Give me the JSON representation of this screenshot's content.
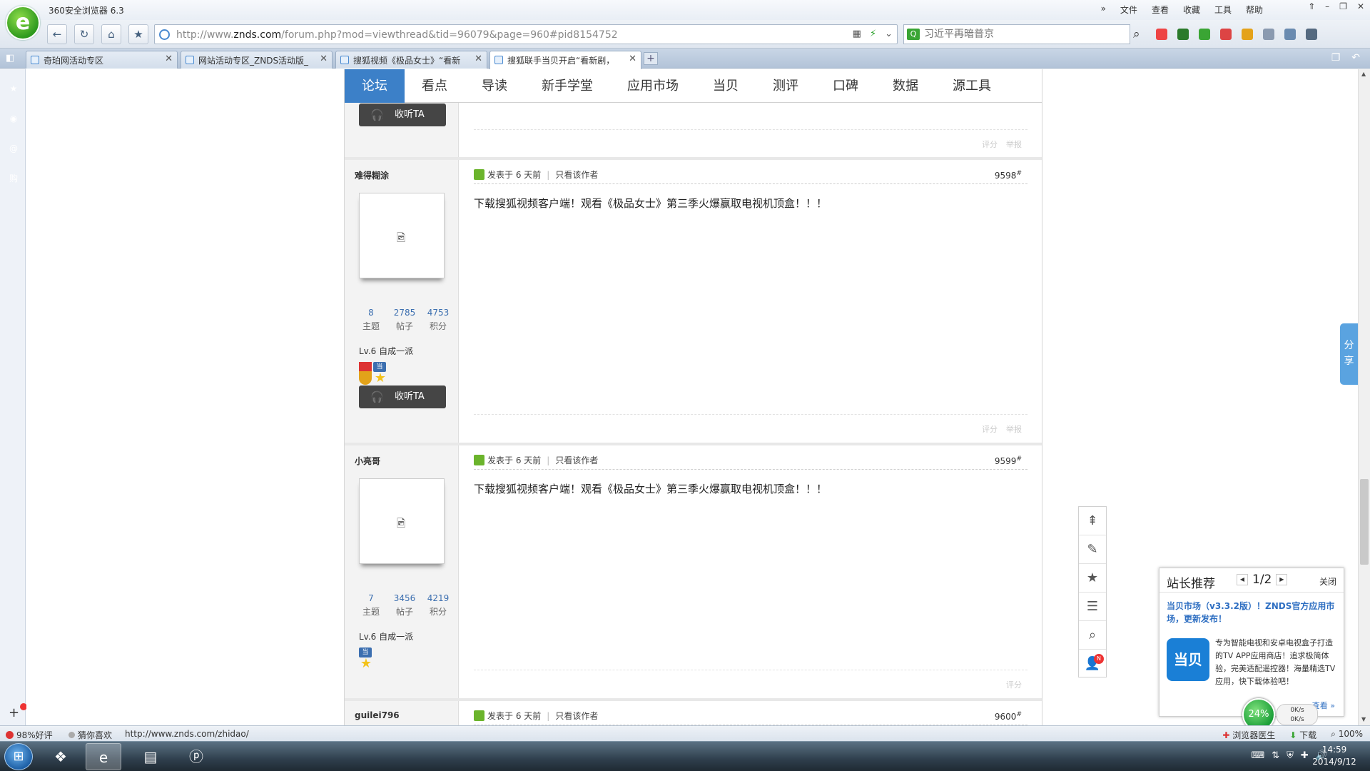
{
  "browser": {
    "title": "360安全浏览器 6.3",
    "logo_glyph": "e",
    "menu": [
      "»",
      "文件",
      "查看",
      "收藏",
      "工具",
      "帮助"
    ],
    "window_controls": [
      "⇑",
      "–",
      "❐",
      "✕"
    ]
  },
  "toolbar": {
    "back": "←",
    "refresh": "↻",
    "home": "⌂",
    "favorite": "★",
    "url_prefix": "http://www.",
    "url_domain": "znds.com",
    "url_path": "/forum.php?mod=viewthread&tid=96079&page=960#pid8154752",
    "url_icons": [
      "▦",
      "⚡",
      "⌄"
    ],
    "search_placeholder": "习近平再暗普京",
    "search_logo": "Q",
    "search_button": "⌕"
  },
  "tabs": [
    {
      "label": "奇珀网活动专区",
      "active": false
    },
    {
      "label": "网站活动专区_ZNDS活动版_",
      "active": false
    },
    {
      "label": "搜狐视频《极品女士》“看新",
      "active": false
    },
    {
      "label": "搜狐联手当贝开启“看新剧，",
      "active": true
    }
  ],
  "tab_new": "+",
  "sidebar": {
    "icons": [
      {
        "name": "favorites-star-icon",
        "glyph": "★",
        "color": "#f3b21a"
      },
      {
        "name": "weibo-icon",
        "glyph": "◉",
        "color": "#e85a1e"
      },
      {
        "name": "email-icon",
        "glyph": "@",
        "color": "#e04c3c"
      },
      {
        "name": "shopping-icon",
        "glyph": "购",
        "color": "#e85a3c"
      }
    ],
    "add": "+"
  },
  "forum_nav": [
    {
      "label": "论坛",
      "active": true
    },
    {
      "label": "看点",
      "active": false
    },
    {
      "label": "导读",
      "active": false
    },
    {
      "label": "新手学堂",
      "active": false
    },
    {
      "label": "应用市场",
      "active": false
    },
    {
      "label": "当贝",
      "active": false
    },
    {
      "label": "测评",
      "active": false
    },
    {
      "label": "口碑",
      "active": false
    },
    {
      "label": "数据",
      "active": false
    },
    {
      "label": "源工具",
      "active": false
    }
  ],
  "common": {
    "follow_label": "收听TA",
    "follow_icon": "🎧",
    "posted": "发表于 6 天前",
    "only_author": "只看该作者",
    "rate": "评分",
    "report": "举报",
    "stat_labels": [
      "主题",
      "帖子",
      "积分"
    ],
    "floor_mark": "#",
    "avatar_glyph": "🖻"
  },
  "posts": [
    {
      "author": "难得糊涂",
      "stats": [
        "8",
        "2785",
        "4753"
      ],
      "level": "Lv.6 自成一派",
      "floor": "9598",
      "content": "下载搜狐视频客户端！观看《极品女士》第三季火爆赢取电视机顶盒！！！"
    },
    {
      "author": "小亮哥",
      "stats": [
        "7",
        "3456",
        "4219"
      ],
      "level": "Lv.6 自成一派",
      "floor": "9599",
      "content": "下载搜狐视频客户端！观看《极品女士》第三季火爆赢取电视机顶盒！！！"
    },
    {
      "author": "guilei796",
      "floor": "9600"
    }
  ],
  "float_tools": [
    "⇞",
    "✎",
    "★",
    "☰",
    "⌕",
    "👤"
  ],
  "float_badge": "N",
  "share_tab": "分享",
  "recommend": {
    "title": "站长推荐",
    "page": "1/2",
    "prev": "◀",
    "next": "▶",
    "close": "关闭",
    "headline": "当贝市场（v3.3.2版）！ZNDS官方应用市场，更新发布！",
    "logo_text": "当贝",
    "desc": "专为智能电视和安卓电视盒子打造的TV APP应用商店！追求极简体验，完美适配遥控器！海量精选TV应用，快下载体验吧！",
    "more": "查看 »"
  },
  "speed": {
    "percent": "24%",
    "up": "0K/s",
    "down": "0K/s"
  },
  "statusbar": {
    "rating": "98%好评",
    "guess": "猜你喜欢",
    "url": "http://www.znds.com/zhidao/",
    "doctor": "浏览器医生",
    "download": "下载",
    "zoom": "100%"
  },
  "taskbar": {
    "start": "⊞",
    "clock_time": "14:59",
    "clock_date": "2014/9/12"
  }
}
